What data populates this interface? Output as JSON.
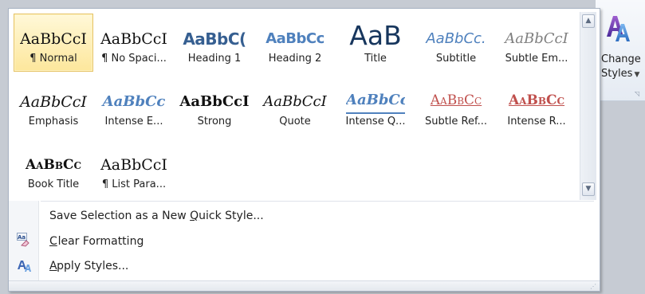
{
  "ribbon": {
    "change_styles_line1": "Change",
    "change_styles_line2": "Styles"
  },
  "gallery": {
    "styles": [
      {
        "sample": "AaBbCcI",
        "name": "¶ Normal"
      },
      {
        "sample": "AaBbCcI",
        "name": "¶ No Spaci..."
      },
      {
        "sample": "AaBbC(",
        "name": "Heading 1"
      },
      {
        "sample": "AaBbCc",
        "name": "Heading 2"
      },
      {
        "sample": "AaB",
        "name": "Title"
      },
      {
        "sample": "AaBbCc.",
        "name": "Subtitle"
      },
      {
        "sample": "AaBbCcI",
        "name": "Subtle Em..."
      },
      {
        "sample": "AaBbCcI",
        "name": "Emphasis"
      },
      {
        "sample": "AaBbCc",
        "name": "Intense E..."
      },
      {
        "sample": "AaBbCcI",
        "name": "Strong"
      },
      {
        "sample": "AaBbCcI",
        "name": "Quote"
      },
      {
        "sample": "AaBbCc",
        "name": "Intense Q..."
      },
      {
        "sample": "AaBbCc",
        "name": "Subtle Ref..."
      },
      {
        "sample": "AaBbCc",
        "name": "Intense R..."
      },
      {
        "sample": "AaBbCc",
        "name": "Book Title"
      },
      {
        "sample": "AaBbCcI",
        "name": "¶ List Para..."
      }
    ]
  },
  "commands": {
    "save_selection": "Save Selection as a New Quick Style...",
    "clear_formatting": "Clear Formatting",
    "apply_styles": "Apply Styles..."
  }
}
